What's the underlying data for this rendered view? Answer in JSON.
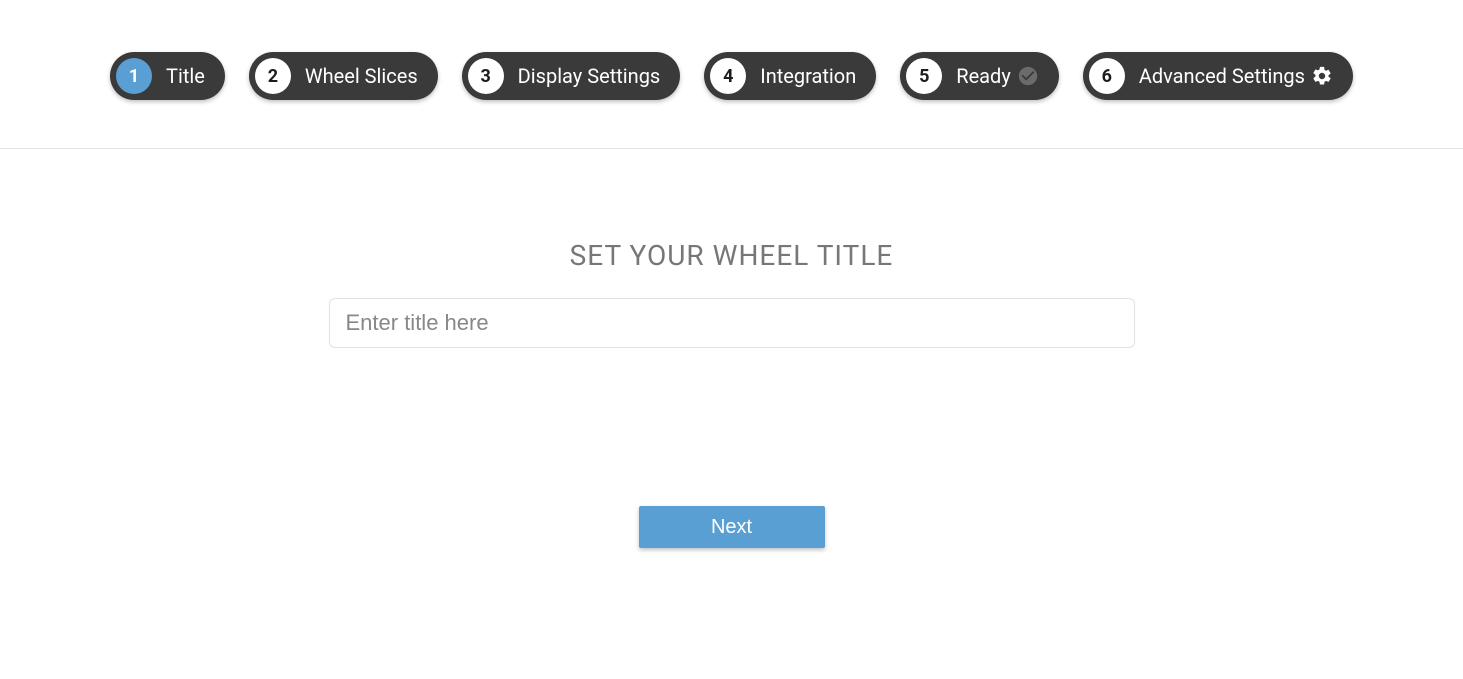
{
  "stepper": {
    "steps": [
      {
        "num": "1",
        "label": "Title",
        "active": true,
        "icon": null
      },
      {
        "num": "2",
        "label": "Wheel Slices",
        "active": false,
        "icon": null
      },
      {
        "num": "3",
        "label": "Display Settings",
        "active": false,
        "icon": null
      },
      {
        "num": "4",
        "label": "Integration",
        "active": false,
        "icon": null
      },
      {
        "num": "5",
        "label": "Ready",
        "active": false,
        "icon": "check"
      },
      {
        "num": "6",
        "label": "Advanced Settings",
        "active": false,
        "icon": "gear"
      }
    ]
  },
  "main": {
    "heading": "SET YOUR WHEEL TITLE",
    "title_input_value": "",
    "title_input_placeholder": "Enter title here",
    "next_label": "Next"
  }
}
